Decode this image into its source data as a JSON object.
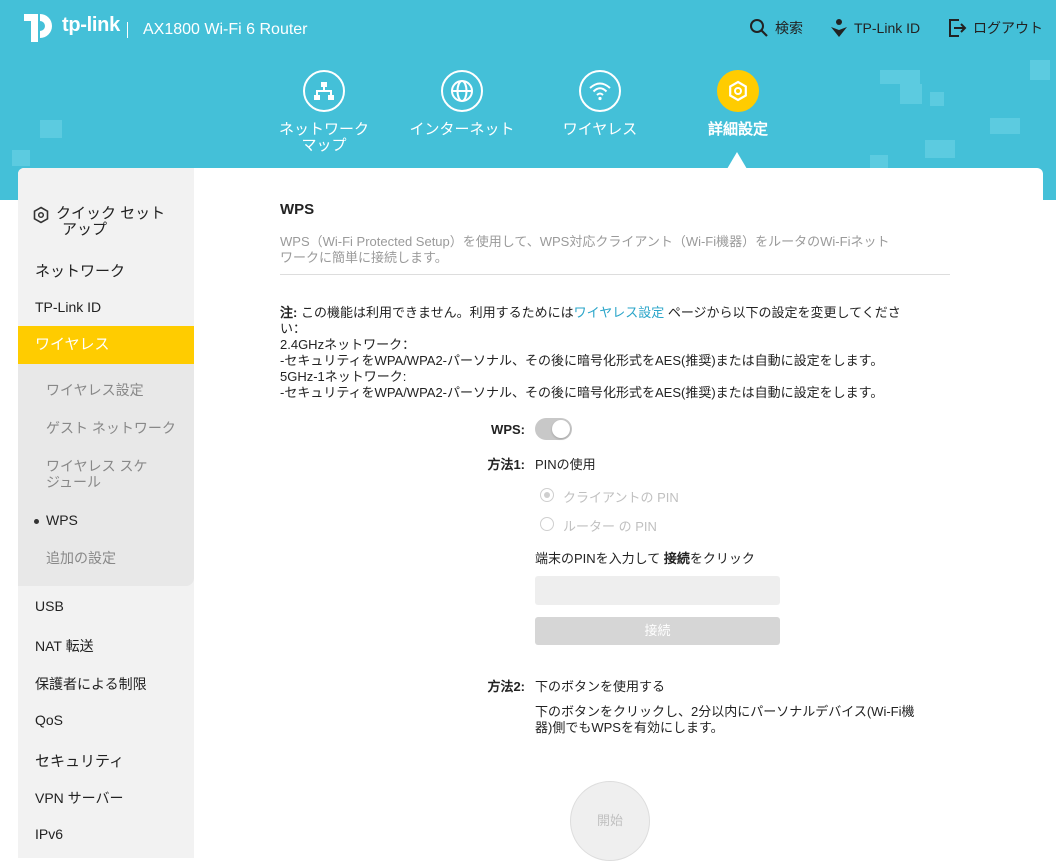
{
  "header": {
    "brand": "tp-link",
    "model": "AX1800 Wi-Fi 6 Router",
    "links": {
      "search": "検索",
      "tplink_id": "TP-Link ID",
      "logout": "ログアウト"
    },
    "accent_color": "#44c0d8"
  },
  "nav": {
    "network_map_l1": "ネットワーク",
    "network_map_l2": "マップ",
    "internet": "インターネット",
    "wireless": "ワイヤレス",
    "advanced": "詳細設定"
  },
  "sidebar": {
    "quick_setup_l1": "クイック セット",
    "quick_setup_l2": "アップ",
    "network": "ネットワーク",
    "tplink_id": "TP-Link ID",
    "wireless": "ワイヤレス",
    "wireless_sub": {
      "settings": "ワイヤレス設定",
      "guest": "ゲスト ネットワーク",
      "schedule_l1": "ワイヤレス スケ",
      "schedule_l2": "ジュール",
      "wps": "WPS",
      "additional": "追加の設定"
    },
    "usb": "USB",
    "nat": "NAT 転送",
    "parental": "保護者による制限",
    "qos": "QoS",
    "security": "セキュリティ",
    "vpn": "VPN サーバー",
    "ipv6": "IPv6"
  },
  "main": {
    "title": "WPS",
    "description_l1": "WPS（Wi-Fi Protected Setup）を使用して、WPS対応クライアント（Wi-Fi機器）をルータのWi-Fiネット",
    "description_l2": "ワークに簡単に接続します。",
    "note_label": "注:",
    "note_text_before": " この機能は利用できません。利用するためには",
    "note_link": "ワイヤレス設定",
    "note_text_after": " ページから以下の設定を変更してくださ",
    "note_line2": "い：",
    "note_line3": "2.4GHzネットワーク：",
    "note_line4": "-セキュリティをWPA/WPA2-パーソナル、その後に暗号化形式をAES(推奨)または自動に設定をします。",
    "note_line5": "5GHz-1ネットワーク:",
    "note_line6": "-セキュリティをWPA/WPA2-パーソナル、その後に暗号化形式をAES(推奨)または自動に設定をします。",
    "wps_label": "WPS:",
    "wps_enabled": true,
    "method1_label": "方法1:",
    "method1_value": "PINの使用",
    "radio_client_pin": "クライアントの PIN",
    "radio_router_pin": "ルーター の PIN",
    "pin_instruction_before": "端末のPINを入力して ",
    "pin_instruction_bold": "接続",
    "pin_instruction_after": "をクリック",
    "pin_value": "",
    "connect_button": "接続",
    "method2_label": "方法2:",
    "method2_value": "下のボタンを使用する",
    "method2_desc_l1": "下のボタンをクリックし、2分以内にパーソナルデバイス(Wi-Fi機",
    "method2_desc_l2": "器)側でもWPSを有効にします。",
    "start_button": "開始"
  }
}
